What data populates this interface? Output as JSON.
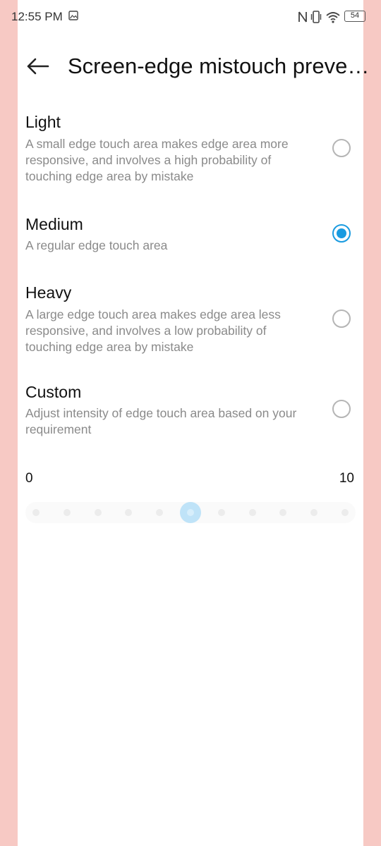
{
  "status_bar": {
    "time": "12:55 PM",
    "battery": "54",
    "icons": [
      "gallery-icon",
      "nfc-icon",
      "vibrate-icon",
      "wifi-icon",
      "battery-icon"
    ]
  },
  "header": {
    "title": "Screen-edge mistouch preve…",
    "back_icon": "back-arrow-icon"
  },
  "options": [
    {
      "title": "Light",
      "description": "A small edge touch area makes edge area more responsive, and involves a high probability of touching edge area by mistake",
      "selected": false
    },
    {
      "title": "Medium",
      "description": "A regular edge touch area",
      "selected": true
    },
    {
      "title": "Heavy",
      "description": "A large edge touch area makes edge area less responsive, and involves a low probability of touching edge area by mistake",
      "selected": false
    },
    {
      "title": "Custom",
      "description": "Adjust intensity of edge touch area based on your requirement",
      "selected": false
    }
  ],
  "slider": {
    "min_label": "0",
    "max_label": "10",
    "min": 0,
    "max": 10,
    "value": 5,
    "enabled": false
  },
  "colors": {
    "accent": "#1a9be0",
    "edge_overlay": "#f7c9c4"
  }
}
